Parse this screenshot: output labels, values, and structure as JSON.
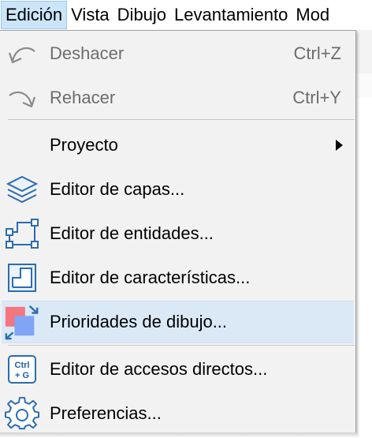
{
  "menubar": {
    "items": [
      "Edición",
      "Vista",
      "Dibujo",
      "Levantamiento",
      "Mod"
    ]
  },
  "menu": {
    "undo": {
      "label": "Deshacer",
      "shortcut": "Ctrl+Z"
    },
    "redo": {
      "label": "Rehacer",
      "shortcut": "Ctrl+Y"
    },
    "project": {
      "label": "Proyecto"
    },
    "layers": {
      "label": "Editor de capas..."
    },
    "entities": {
      "label": "Editor de entidades..."
    },
    "features": {
      "label": "Editor de características..."
    },
    "priorities": {
      "label": "Prioridades de dibujo..."
    },
    "shortcuts": {
      "label": "Editor de accesos directos...",
      "icon_text_1": "Ctrl",
      "icon_text_2": "+ G"
    },
    "preferences": {
      "label": "Preferencias..."
    }
  },
  "colors": {
    "accent_blue": "#2b6cb0",
    "highlight": "#dbe9f7",
    "menubar_active": "#cce4f7",
    "priority_red": "#f4767e",
    "priority_blue": "#7fa5f4"
  }
}
